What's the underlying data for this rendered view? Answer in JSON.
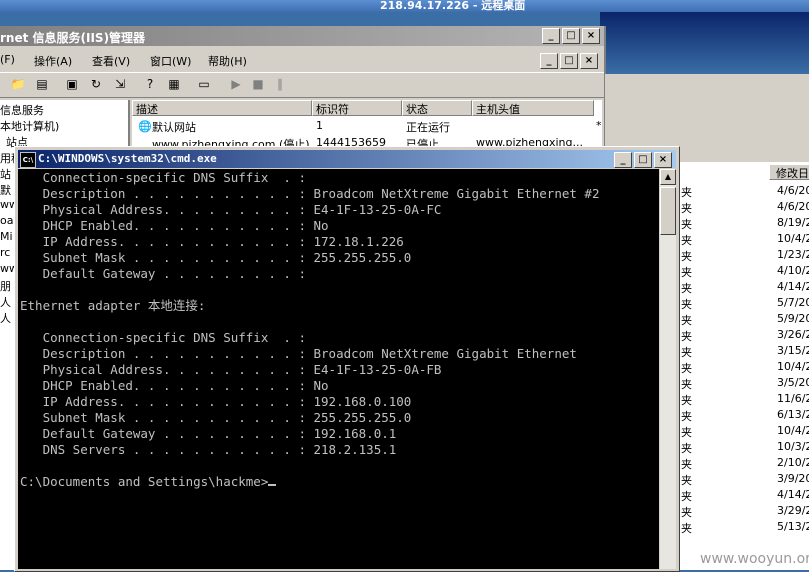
{
  "rdp": {
    "title": "218.94.17.226 - 远程桌面"
  },
  "iis": {
    "title": "rnet 信息服务(IIS)管理器",
    "menu": [
      "(F)",
      "操作(A)",
      "查看(V)",
      "窗口(W)",
      "帮助(H)"
    ],
    "tree": [
      "信息服务",
      "本地计算机)",
      "站点",
      "用程",
      "站",
      "默",
      "ww",
      "oa",
      "Mi",
      "rc",
      "ww",
      "朋",
      "人",
      "人"
    ],
    "list": {
      "headers": [
        "描述",
        "标识符",
        "状态",
        "主机头值"
      ],
      "rows": [
        [
          "默认网站",
          "1",
          "正在运行",
          "",
          "*"
        ],
        [
          "www.pizhengxing.com (停止)",
          "1444153659",
          "已停止",
          "www.pizhengxing...",
          "*"
        ]
      ]
    }
  },
  "explorer": {
    "column_header": "修改日",
    "types": [
      "夹",
      "夹",
      "夹",
      "夹",
      "夹",
      "夹",
      "夹",
      "夹",
      "夹",
      "夹",
      "夹",
      "夹",
      "夹",
      "夹",
      "夹",
      "夹",
      "夹",
      "夹",
      "夹",
      "夹",
      "夹",
      "夹",
      "夹",
      "夹"
    ],
    "dates": [
      "4/6/20",
      "4/6/20",
      "8/19/2",
      "10/4/2",
      "1/23/2",
      "4/10/2",
      "4/14/2",
      "5/7/20",
      "5/9/20",
      "3/26/2",
      "3/15/2",
      "10/4/2",
      "3/5/20",
      "11/6/2",
      "6/13/2",
      "10/4/2",
      "10/3/2",
      "2/10/2",
      "3/9/20",
      "4/14/2",
      "3/29/2",
      "5/13/2"
    ]
  },
  "cmd": {
    "title": "C:\\WINDOWS\\system32\\cmd.exe",
    "lines": [
      "   Connection-specific DNS Suffix  . :",
      "   Description . . . . . . . . . . . : Broadcom NetXtreme Gigabit Ethernet #2",
      "   Physical Address. . . . . . . . . : E4-1F-13-25-0A-FC",
      "   DHCP Enabled. . . . . . . . . . . : No",
      "   IP Address. . . . . . . . . . . . : 172.18.1.226",
      "   Subnet Mask . . . . . . . . . . . : 255.255.255.0",
      "   Default Gateway . . . . . . . . . :",
      "",
      "Ethernet adapter 本地连接:",
      "",
      "   Connection-specific DNS Suffix  . :",
      "   Description . . . . . . . . . . . : Broadcom NetXtreme Gigabit Ethernet",
      "   Physical Address. . . . . . . . . : E4-1F-13-25-0A-FB",
      "   DHCP Enabled. . . . . . . . . . . : No",
      "   IP Address. . . . . . . . . . . . : 192.168.0.100",
      "   Subnet Mask . . . . . . . . . . . : 255.255.255.0",
      "   Default Gateway . . . . . . . . . : 192.168.0.1",
      "   DNS Servers . . . . . . . . . . . : 218.2.135.1",
      ""
    ],
    "prompt": "C:\\Documents and Settings\\hackme>"
  },
  "watermark": "www.wooyun.org",
  "icons": {
    "minimize": "_",
    "maximize": "□",
    "close": "×"
  }
}
